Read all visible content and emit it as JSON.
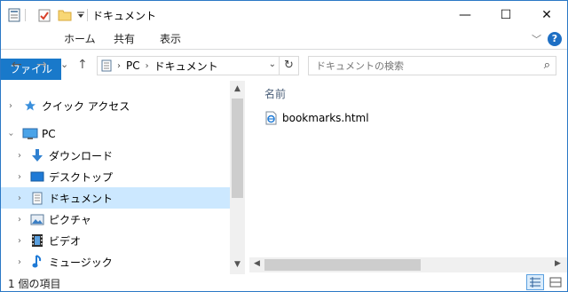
{
  "window": {
    "title": "ドキュメント",
    "accent_color": "#1979ca",
    "selected_bg": "#cce8ff"
  },
  "quick_access_toolbar": {
    "icons": [
      "properties-icon",
      "new-folder-check-icon",
      "folder-icon",
      "customize-dropdown-icon"
    ]
  },
  "caption_buttons": {
    "minimize": "—",
    "maximize": "☐",
    "close": "✕"
  },
  "ribbon": {
    "tabs": [
      "ファイル",
      "ホーム",
      "共有",
      "表示"
    ],
    "expand_icon": "﹀",
    "help_icon": "?"
  },
  "navigation": {
    "back": "←",
    "forward": "→",
    "recent": "⌄",
    "up": "↑"
  },
  "address_bar": {
    "crumbs": [
      "PC",
      "ドキュメント"
    ],
    "separator": "›",
    "dropdown": "⌄",
    "refresh": "↻"
  },
  "search": {
    "placeholder": "ドキュメントの検索",
    "icon": "⌕"
  },
  "nav_pane": {
    "items": [
      {
        "label": "クイック アクセス",
        "icon": "star-icon",
        "expanded": false,
        "selected": false
      },
      {
        "label": "PC",
        "icon": "computer-icon",
        "expanded": true,
        "selected": false
      },
      {
        "label": "ダウンロード",
        "icon": "download-arrow-icon",
        "expanded": false,
        "selected": false
      },
      {
        "label": "デスクトップ",
        "icon": "desktop-icon",
        "expanded": false,
        "selected": false
      },
      {
        "label": "ドキュメント",
        "icon": "document-icon",
        "expanded": false,
        "selected": true
      },
      {
        "label": "ピクチャ",
        "icon": "picture-icon",
        "expanded": false,
        "selected": false
      },
      {
        "label": "ビデオ",
        "icon": "film-icon",
        "expanded": false,
        "selected": false
      },
      {
        "label": "ミュージック",
        "icon": "music-note-icon",
        "expanded": false,
        "selected": false
      }
    ]
  },
  "content": {
    "column_header": "名前",
    "files": [
      {
        "name": "bookmarks.html",
        "icon": "html-file-icon"
      }
    ]
  },
  "status_bar": {
    "text": "1 個の項目"
  }
}
